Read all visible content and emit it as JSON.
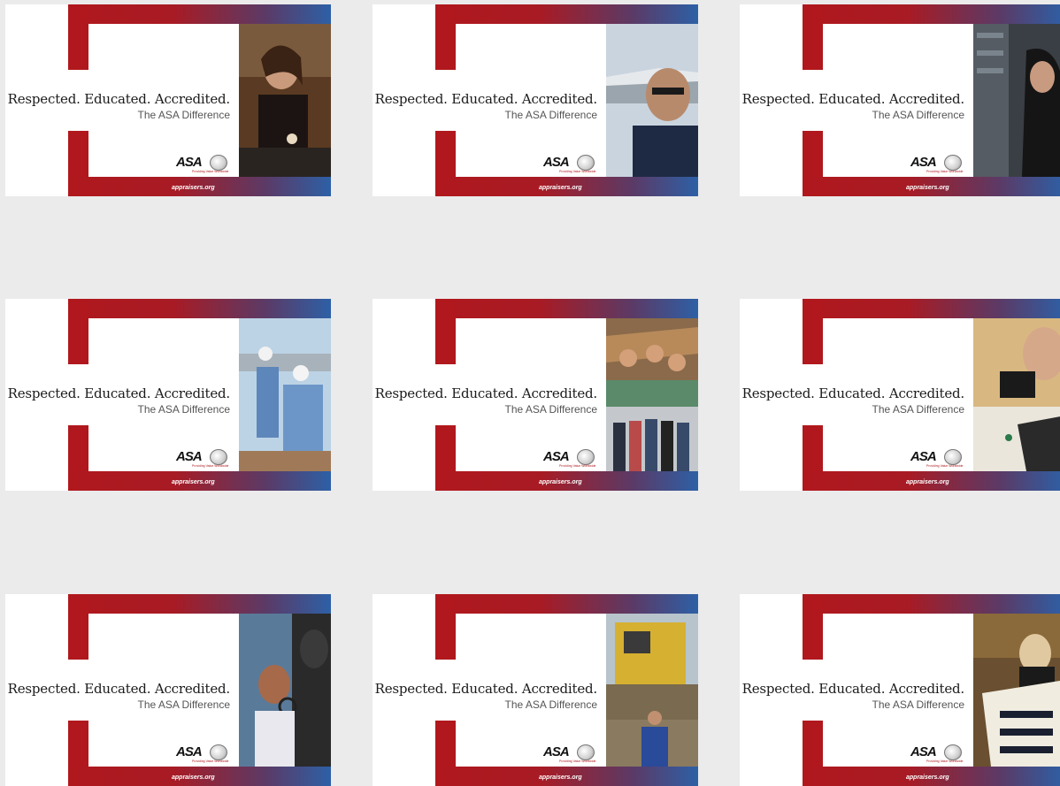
{
  "cards": [
    {
      "tagline": "Respected. Educated. Accredited.",
      "subline": "The ASA Difference",
      "logo": "ASA",
      "logo_tag": "Providing Value Worldwide",
      "url": "appraisers.org",
      "photo": "woman-with-glasses-examining-jewelry"
    },
    {
      "tagline": "Respected. Educated. Accredited.",
      "subline": "The ASA Difference",
      "logo": "ASA",
      "logo_tag": "Providing Value Worldwide",
      "url": "appraisers.org",
      "photo": "man-with-glasses-by-airplane"
    },
    {
      "tagline": "Respected. Educated. Accredited.",
      "subline": "The ASA Difference",
      "logo": "ASA",
      "logo_tag": "Providing Value Worldwide",
      "url": "appraisers.org",
      "photo": "woman-with-tablet-in-server-room"
    },
    {
      "tagline": "Respected. Educated. Accredited.",
      "subline": "The ASA Difference",
      "logo": "ASA",
      "logo_tag": "Providing Value Worldwide",
      "url": "appraisers.org",
      "photo": "workers-in-hardhats-on-rooftop"
    },
    {
      "tagline": "Respected. Educated. Accredited.",
      "subline": "The ASA Difference",
      "logo": "ASA",
      "logo_tag": "Providing Value Worldwide",
      "url": "appraisers.org",
      "photo": "mural-and-group-photo"
    },
    {
      "tagline": "Respected. Educated. Accredited.",
      "subline": "The ASA Difference",
      "logo": "ASA",
      "logo_tag": "Providing Value Worldwide",
      "url": "appraisers.org",
      "photo": "man-examining-textile-with-magnifier"
    },
    {
      "tagline": "Respected. Educated. Accredited.",
      "subline": "The ASA Difference",
      "logo": "ASA",
      "logo_tag": "Providing Value Worldwide",
      "url": "appraisers.org",
      "photo": "woman-with-magnifying-glass-near-statue"
    },
    {
      "tagline": "Respected. Educated. Accredited.",
      "subline": "The ASA Difference",
      "logo": "ASA",
      "logo_tag": "Providing Value Worldwide",
      "url": "appraisers.org",
      "photo": "man-in-coveralls-by-bulldozer"
    },
    {
      "tagline": "Respected. Educated. Accredited.",
      "subline": "The ASA Difference",
      "logo": "ASA",
      "logo_tag": "Providing Value Worldwide",
      "url": "appraisers.org",
      "photo": "woman-examining-quilt"
    }
  ],
  "colors": {
    "brand_red": "#b0181d",
    "brand_blue": "#2d60a6",
    "background": "#ebebeb"
  }
}
